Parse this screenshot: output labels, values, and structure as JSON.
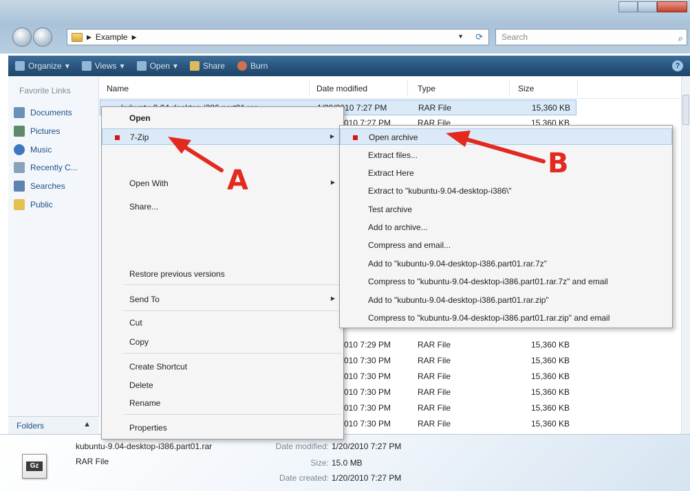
{
  "address": {
    "crumbs": [
      "Example"
    ],
    "search_placeholder": "Search"
  },
  "toolbar": {
    "items": [
      "Organize",
      "Views",
      "Open",
      "Share",
      "Burn"
    ]
  },
  "navpane": {
    "title": "Favorite Links",
    "items": [
      "Documents",
      "Pictures",
      "Music",
      "Recently C...",
      "Searches",
      "Public"
    ],
    "folders_label": "Folders"
  },
  "filelist": {
    "columns": [
      "Name",
      "Date modified",
      "Type",
      "Size"
    ],
    "top_rows": [
      {
        "name": "kubuntu-9.04-desktop-i386.part01.rar",
        "date": "1/20/2010 7:27 PM",
        "type": "RAR File",
        "size": "15,360 KB"
      },
      {
        "date": "010 7:27 PM",
        "type": "RAR File",
        "size": "15,360 KB"
      }
    ],
    "bottom_rows": [
      {
        "date": "010 7:29 PM",
        "type": "RAR File",
        "size": "15,360 KB"
      },
      {
        "date": "010 7:30 PM",
        "type": "RAR File",
        "size": "15,360 KB"
      },
      {
        "date": "010 7:30 PM",
        "type": "RAR File",
        "size": "15,360 KB"
      },
      {
        "date": "010 7:30 PM",
        "type": "RAR File",
        "size": "15,360 KB"
      },
      {
        "date": "010 7:30 PM",
        "type": "RAR File",
        "size": "15,360 KB"
      },
      {
        "date": "010 7:30 PM",
        "type": "RAR File",
        "size": "15,360 KB"
      }
    ]
  },
  "context_menu": {
    "items": [
      "Open",
      "7-Zip",
      "Open With",
      "Share...",
      "Restore previous versions",
      "Send To",
      "Cut",
      "Copy",
      "Create Shortcut",
      "Delete",
      "Rename",
      "Properties"
    ]
  },
  "submenu": {
    "items": [
      "Open archive",
      "Extract files...",
      "Extract Here",
      "Extract to \"kubuntu-9.04-desktop-i386\\\"",
      "Test archive",
      "Add to archive...",
      "Compress and email...",
      "Add to \"kubuntu-9.04-desktop-i386.part01.rar.7z\"",
      "Compress to \"kubuntu-9.04-desktop-i386.part01.rar.7z\" and email",
      "Add to \"kubuntu-9.04-desktop-i386.part01.rar.zip\"",
      "Compress to \"kubuntu-9.04-desktop-i386.part01.rar.zip\" and email"
    ]
  },
  "details": {
    "icon_text": "Gz",
    "filename": "kubuntu-9.04-desktop-i386.part01.rar",
    "filetype": "RAR File",
    "modified_label": "Date modified:",
    "modified_value": "1/20/2010 7:27 PM",
    "size_label": "Size:",
    "size_value": "15.0 MB",
    "created_label": "Date created:",
    "created_value": "1/20/2010 7:27 PM"
  },
  "annotations": {
    "a": "A",
    "b": "B"
  },
  "colors": {
    "arrow": "#e22a1f",
    "bullet": "#d0181c",
    "toolbar": "#2a5680",
    "highlight": "#dce9f7"
  }
}
